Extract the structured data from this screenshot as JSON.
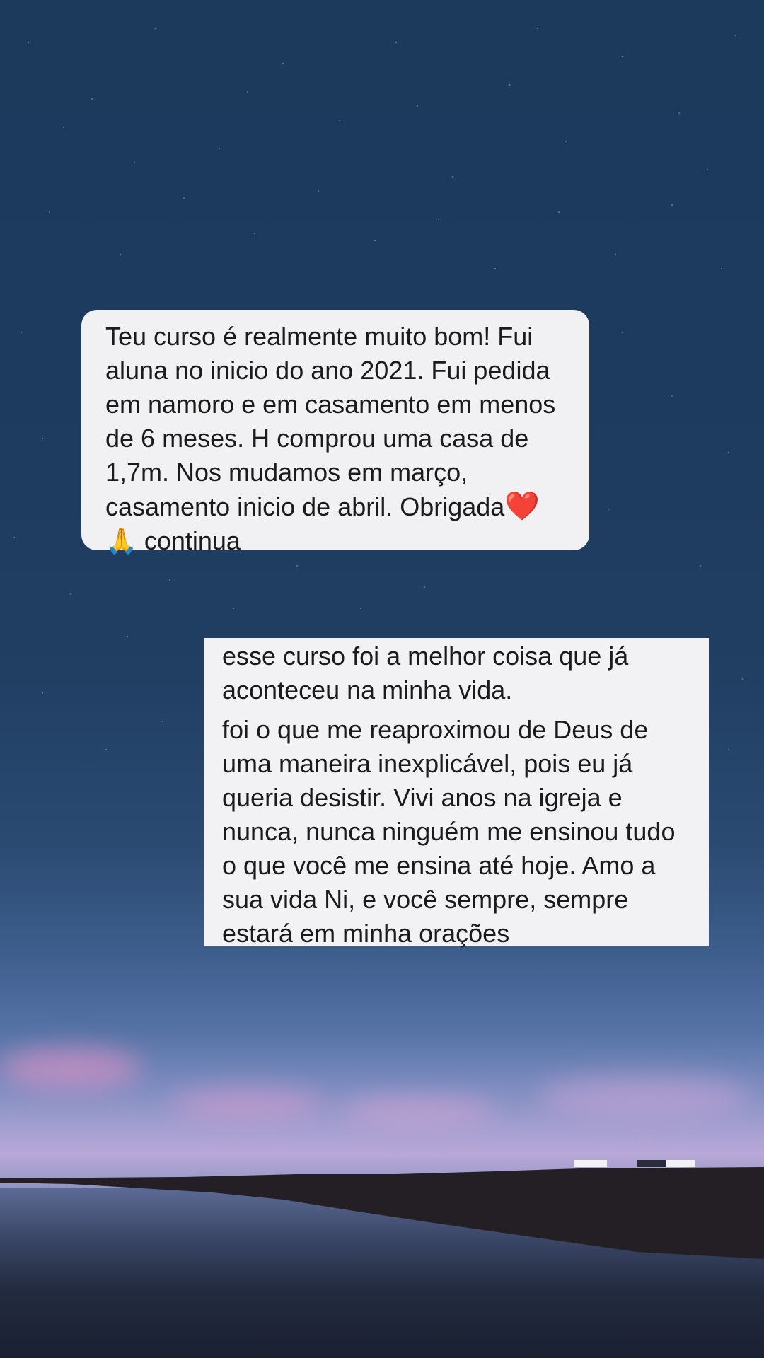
{
  "messages": [
    {
      "text_lines": [
        "Teu curso é realmente muito bom! Fui",
        "aluna no inicio do ano 2021. Fui pedida",
        "em namoro e em casamento em menos",
        "de 6 meses. H comprou uma casa de",
        "1,7m. Nos mudamos em março,",
        "casamento inicio de abril. Obrigada"
      ],
      "heart_emoji": "❤️",
      "pray_emoji": "🙏",
      "last_line": "continua"
    },
    {
      "paragraph_1": "esse curso foi a melhor coisa que já\naconteceu na minha vida.",
      "paragraph_2": "foi o que me reaproximou de Deus de\numa maneira inexplicável, pois eu já\nqueria desistir. Vivi anos na igreja e\nnunca, nunca ninguém me ensinou tudo\no que você me ensina até hoje. Amo a\nsua vida Ni, e você sempre, sempre\nestará em minha orações"
    }
  ]
}
